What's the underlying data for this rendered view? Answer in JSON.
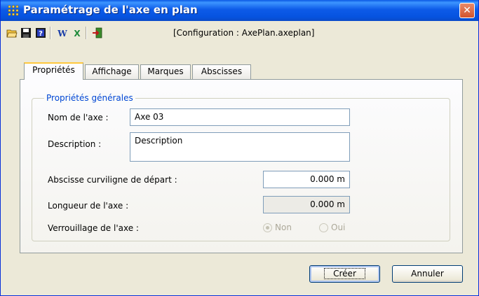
{
  "window": {
    "title": "Paramétrage de l'axe en plan",
    "close_label": "✕"
  },
  "toolbar": {
    "icons": [
      "open-folder-icon",
      "save-icon",
      "help-icon",
      "word-export-icon",
      "excel-export-icon",
      "exit-icon"
    ],
    "config_label": "[Configuration : AxePlan.axeplan]"
  },
  "tabs": [
    {
      "label": "Propriétés",
      "active": true
    },
    {
      "label": "Affichage",
      "active": false
    },
    {
      "label": "Marques",
      "active": false
    },
    {
      "label": "Abscisses",
      "active": false
    }
  ],
  "group": {
    "title": "Propriétés générales",
    "name_label": "Nom de l'axe :",
    "name_value": "Axe 03",
    "description_label": "Description :",
    "description_value": "Description",
    "start_label": "Abscisse curviligne de départ :",
    "start_value": "0.000 m",
    "length_label": "Longueur de l'axe :",
    "length_value": "0.000 m",
    "lock_label": "Verrouillage de l'axe :",
    "lock_options": [
      "Non",
      "Oui"
    ],
    "lock_selected": "Non"
  },
  "buttons": {
    "create": "Créer",
    "cancel": "Annuler"
  },
  "colors": {
    "title_bar": "#0a58e4",
    "accent": "#ffc83c",
    "group_title": "#0046d5"
  }
}
